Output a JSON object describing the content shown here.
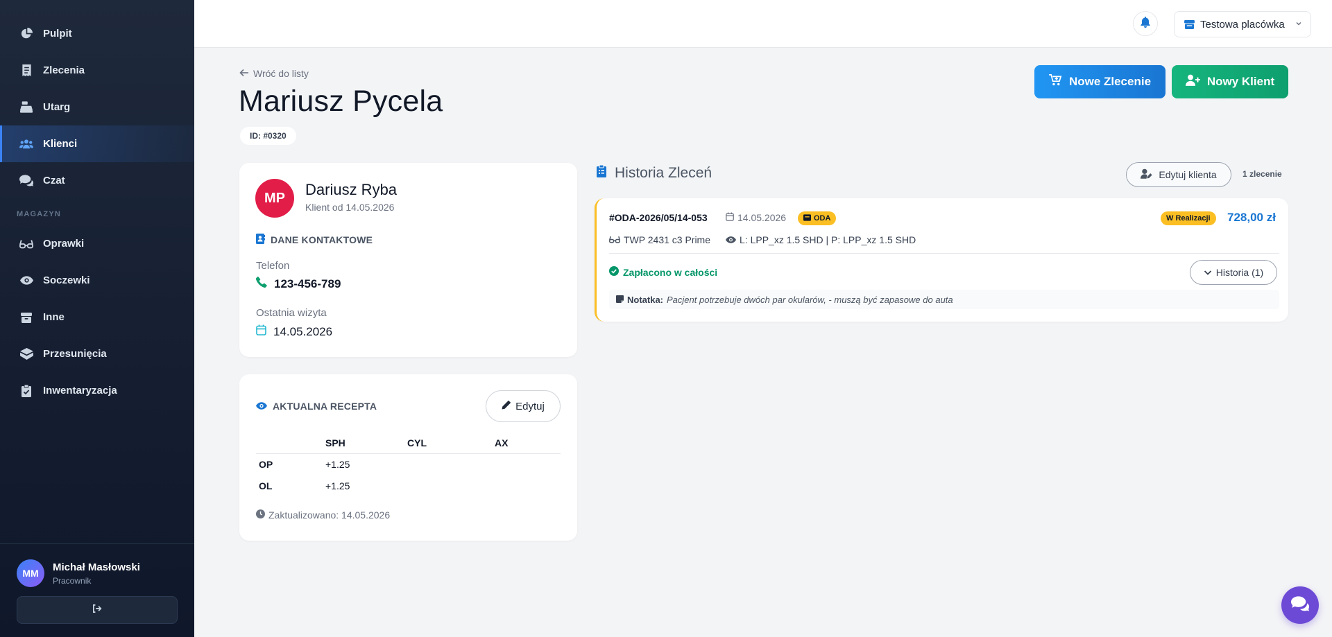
{
  "sidebar": {
    "items": [
      {
        "label": "Pulpit",
        "icon": "chart-pie-icon"
      },
      {
        "label": "Zlecenia",
        "icon": "receipt-icon"
      },
      {
        "label": "Utarg",
        "icon": "cash-register-icon"
      },
      {
        "label": "Klienci",
        "icon": "users-icon",
        "active": true
      },
      {
        "label": "Czat",
        "icon": "comments-icon"
      }
    ],
    "section_label": "MAGAZYN",
    "warehouse_items": [
      {
        "label": "Oprawki",
        "icon": "glasses-icon"
      },
      {
        "label": "Soczewki",
        "icon": "eye-icon"
      },
      {
        "label": "Inne",
        "icon": "box-icon"
      },
      {
        "label": "Przesunięcia",
        "icon": "boxes-icon"
      },
      {
        "label": "Inwentaryzacja",
        "icon": "clipboard-check-icon"
      }
    ],
    "user": {
      "initials": "MM",
      "name": "Michał Masłowski",
      "role": "Pracownik"
    }
  },
  "topbar": {
    "branch": "Testowa placówka"
  },
  "page": {
    "back_label": "Wróć do listy",
    "title": "Mariusz Pycela",
    "id_badge": "ID: #0320",
    "new_order_label": "Nowe Zlecenie",
    "new_client_label": "Nowy Klient"
  },
  "contact": {
    "initials": "MP",
    "name": "Dariusz Ryba",
    "since": "Klient od 14.05.2026",
    "section_title": "DANE KONTAKTOWE",
    "phone_label": "Telefon",
    "phone": "123-456-789",
    "last_visit_label": "Ostatnia wizyta",
    "last_visit": "14.05.2026"
  },
  "prescription": {
    "section_title": "AKTUALNA RECEPTA",
    "edit_label": "Edytuj",
    "columns": [
      "",
      "SPH",
      "CYL",
      "AX"
    ],
    "rows": [
      {
        "eye": "OP",
        "sph": "+1.25",
        "cyl": "",
        "ax": ""
      },
      {
        "eye": "OL",
        "sph": "+1.25",
        "cyl": "",
        "ax": ""
      }
    ],
    "updated": "Zaktualizowano: 14.05.2026"
  },
  "history": {
    "title": "Historia Zleceń",
    "edit_client_label": "Edytuj klienta",
    "count": "1 zlecenie",
    "orders": [
      {
        "number": "#ODA-2026/05/14-053",
        "date": "14.05.2026",
        "type_badge": "ODA",
        "status": "W Realizacji",
        "amount": "728,00 zł",
        "frame": "TWP 2431 c3 Prime",
        "lenses": "L: LPP_xz 1.5 SHD | P: LPP_xz 1.5 SHD",
        "payment": "Zapłacono w całości",
        "history_label": "Historia (1)",
        "note_label": "Notatka:",
        "note": "Pacjent potrzebuje dwóch par okularów, - muszą być zapasowe do auta"
      }
    ]
  },
  "colors": {
    "accent_blue": "#1976d2",
    "accent_green": "#0e9f6e",
    "status_yellow": "#fbbf24",
    "avatar_red": "#e11d48",
    "chat_purple": "#6d4ad6"
  }
}
